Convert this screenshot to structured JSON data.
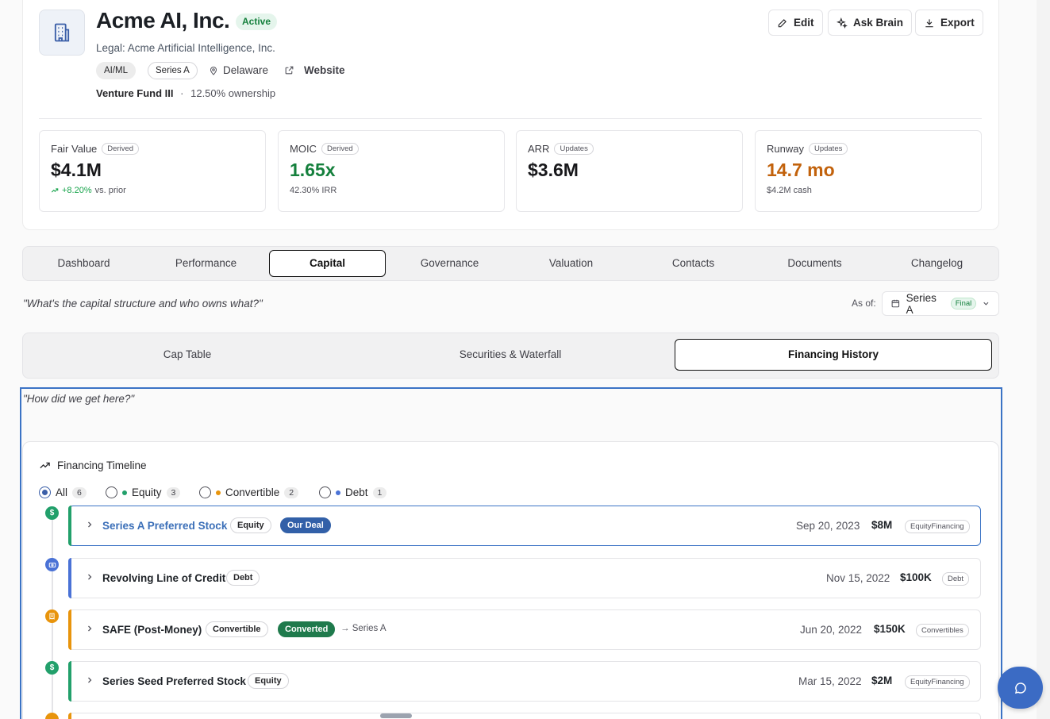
{
  "company": {
    "name": "Acme AI, Inc.",
    "status": "Active",
    "legal": "Legal: Acme Artificial Intelligence, Inc.",
    "tags": [
      "AI/ML",
      "Series A"
    ],
    "location": "Delaware",
    "website_label": "Website",
    "fund": "Venture Fund III",
    "ownership": "12.50% ownership"
  },
  "actions": {
    "edit": "Edit",
    "ask_brain": "Ask Brain",
    "export": "Export"
  },
  "metrics": [
    {
      "label": "Fair Value",
      "tag": "Derived",
      "value": "$4.1M",
      "sub_change": "+8.20%",
      "sub_text": "vs. prior"
    },
    {
      "label": "MOIC",
      "tag": "Derived",
      "value": "1.65x",
      "sub_text": "42.30% IRR"
    },
    {
      "label": "ARR",
      "tag": "Updates",
      "value": "$3.6M",
      "sub_text": ""
    },
    {
      "label": "Runway",
      "tag": "Updates",
      "value": "14.7 mo",
      "sub_text": "$4.2M cash"
    }
  ],
  "tabs": [
    "Dashboard",
    "Performance",
    "Capital",
    "Governance",
    "Valuation",
    "Contacts",
    "Documents",
    "Changelog"
  ],
  "capital": {
    "question": "\"What's the capital structure and who owns what?\"",
    "as_of_label": "As of:",
    "as_of_value": "Series A",
    "as_of_badge": "Final"
  },
  "subtabs": [
    "Cap Table",
    "Securities & Waterfall",
    "Financing History"
  ],
  "history": {
    "question": "\"How did we get here?\"",
    "timeline_title": "Financing Timeline",
    "filters": [
      {
        "label": "All",
        "count": "6"
      },
      {
        "label": "Equity",
        "count": "3"
      },
      {
        "label": "Convertible",
        "count": "2"
      },
      {
        "label": "Debt",
        "count": "1"
      }
    ],
    "rounds": [
      {
        "name": "Series A Preferred Stock",
        "chip": "Equity",
        "badge": "Our Deal",
        "date": "Sep 20, 2023",
        "amount": "$8M",
        "type": "EquityFinancing"
      },
      {
        "name": "Revolving Line of Credit",
        "chip": "Debt",
        "date": "Nov 15, 2022",
        "amount": "$100K",
        "type": "Debt"
      },
      {
        "name": "SAFE (Post-Money)",
        "chip": "Convertible",
        "badge": "Converted",
        "note": "→ Series A",
        "date": "Jun 20, 2022",
        "amount": "$150K",
        "type": "Convertibles"
      },
      {
        "name": "Series Seed Preferred Stock",
        "chip": "Equity",
        "date": "Mar 15, 2022",
        "amount": "$2M",
        "type": "EquityFinancing"
      }
    ]
  },
  "colors": {
    "equity": "#22a06b",
    "convertible": "#e8940c",
    "debt": "#4a72d6",
    "accent": "#3b73c5"
  }
}
